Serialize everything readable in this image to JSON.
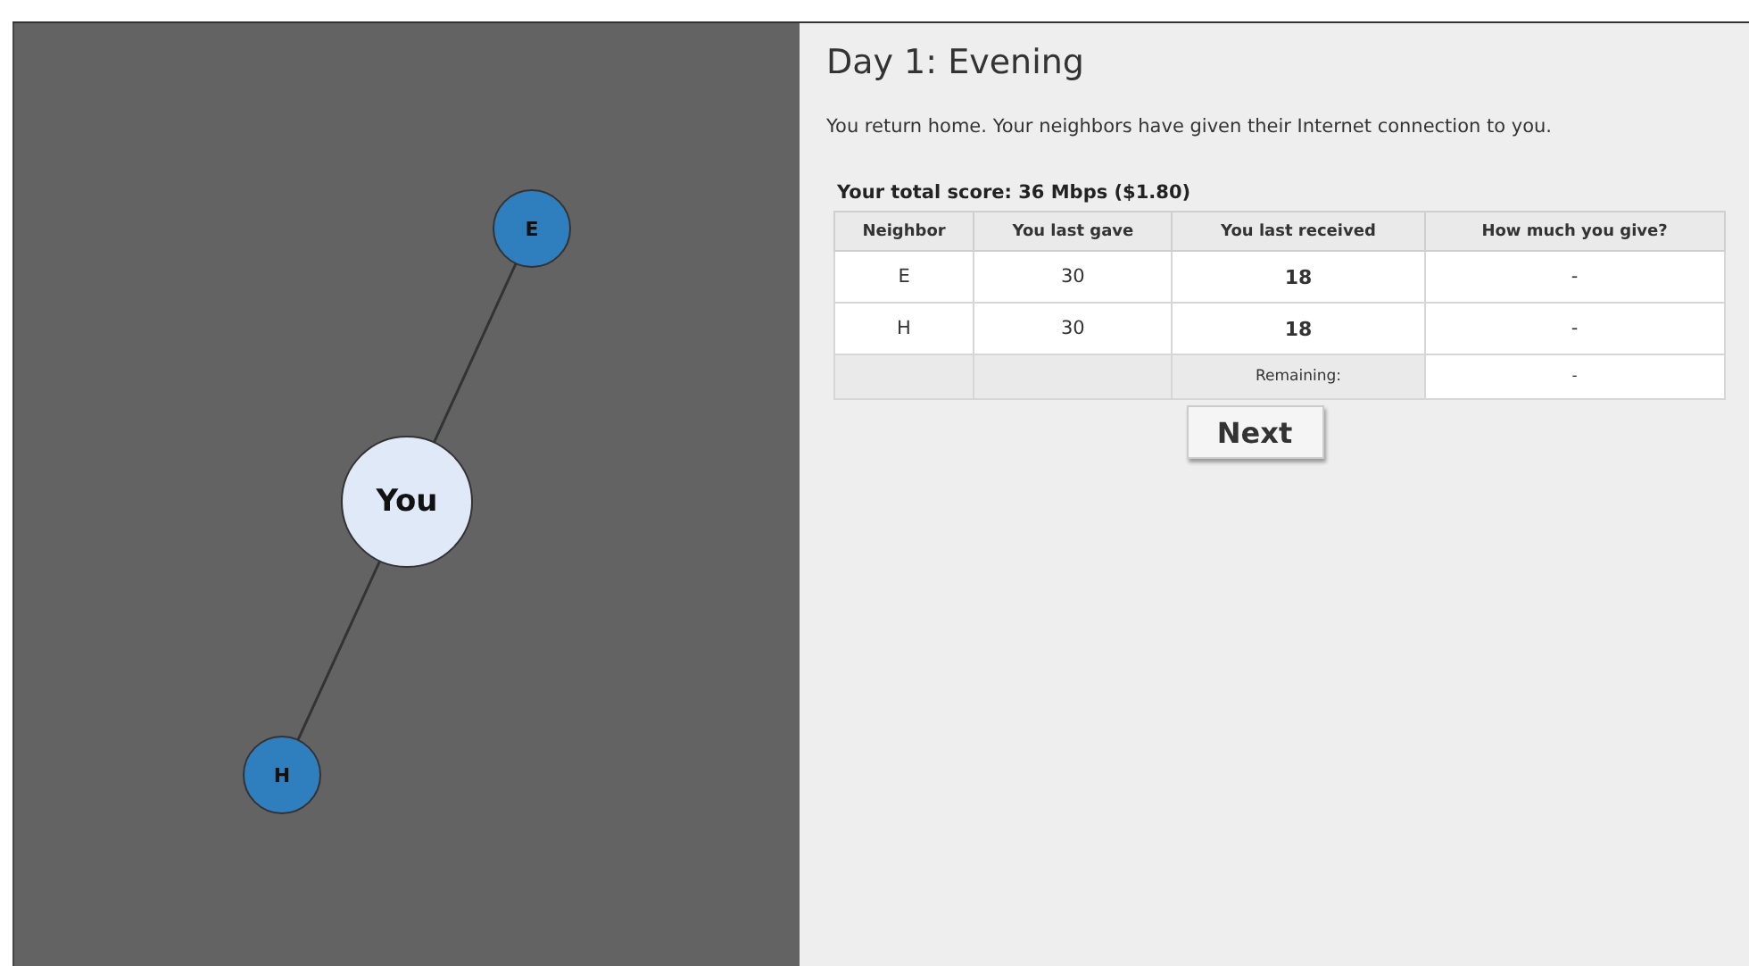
{
  "graph": {
    "nodes": [
      {
        "label": "E",
        "color": "#2f7fbf",
        "connected": true
      },
      {
        "label": "You",
        "color": "#dfe9f7",
        "center": true
      },
      {
        "label": "H",
        "color": "#2f7fbf",
        "connected": true
      }
    ]
  },
  "panel": {
    "title": "Day 1: Evening",
    "message": "You return home. Your neighbors have given their Internet connection to you.",
    "score": "Your total score: 36 Mbps ($1.80)",
    "table": {
      "columns": [
        "Neighbor",
        "You last gave",
        "You last received",
        "How much you give?"
      ],
      "rows": [
        {
          "kind": "neighbor",
          "cells": [
            "E",
            "30",
            "18",
            "-"
          ]
        },
        {
          "kind": "neighbor",
          "cells": [
            "H",
            "30",
            "18",
            "-"
          ]
        },
        {
          "kind": "summary",
          "label": "Remaining:",
          "value": "-"
        }
      ]
    },
    "button": "Next"
  }
}
